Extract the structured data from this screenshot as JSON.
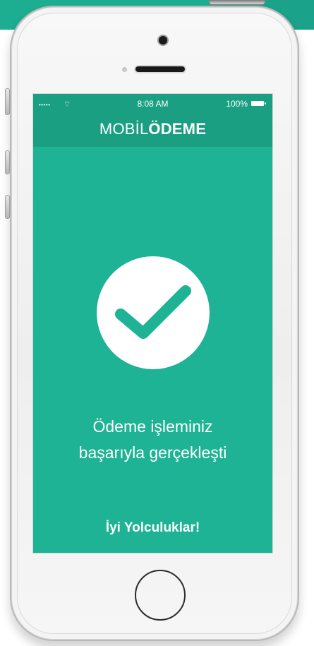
{
  "status_bar": {
    "signal": "•••••",
    "wifi_icon": "wifi-icon",
    "time": "8:08 AM",
    "battery": "100%"
  },
  "header": {
    "brand_light": "MOBİL",
    "brand_bold": "ÖDEME"
  },
  "content": {
    "success_icon": "check-icon",
    "message_line_1": "Ödeme işleminiz",
    "message_line_2": "başarıyla gerçekleşti",
    "footer": "İyi Yolculuklar!"
  },
  "colors": {
    "accent": "#1db394",
    "header": "#1a9f82",
    "icon_check": "#1db394",
    "text": "#ffffff"
  }
}
